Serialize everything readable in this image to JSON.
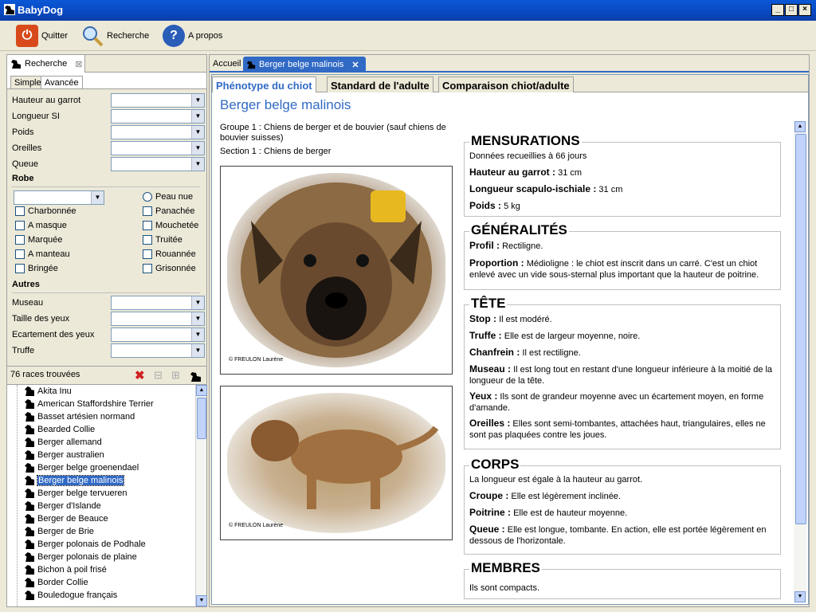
{
  "window": {
    "title": "BabyDog"
  },
  "toolbar": {
    "quit_label": "Quitter",
    "search_label": "Recherche",
    "about_label": "A propos"
  },
  "left": {
    "view_tab": "Recherche",
    "subtab_simple": "Simple",
    "subtab_advanced": "Avancée",
    "fields": [
      {
        "label": "Hauteur au garrot"
      },
      {
        "label": "Longueur SI"
      },
      {
        "label": "Poids"
      },
      {
        "label": "Oreilles"
      },
      {
        "label": "Queue"
      }
    ],
    "robe_heading": "Robe",
    "robe_radio": "Peau nue",
    "robe_checks_left": [
      "Charbonnée",
      "A masque",
      "Marquée",
      "A manteau",
      "Bringée"
    ],
    "robe_checks_right": [
      "Panachée",
      "Mouchetée",
      "Truitée",
      "Rouannée",
      "Grisonnée"
    ],
    "autres_heading": "Autres",
    "autres_fields": [
      {
        "label": "Museau"
      },
      {
        "label": "Taille des yeux"
      },
      {
        "label": "Ecartement des yeux"
      },
      {
        "label": "Truffe"
      }
    ],
    "results_count": "76 races trouvées",
    "breeds": [
      "Akita Inu",
      "American Staffordshire Terrier",
      "Basset artésien normand",
      "Bearded Collie",
      "Berger allemand",
      "Berger australien",
      "Berger belge groenendael",
      "Berger belge malinois",
      "Berger belge tervueren",
      "Berger d'Islande",
      "Berger de Beauce",
      "Berger de Brie",
      "Berger polonais de Podhale",
      "Berger polonais de plaine",
      "Bichon à poil frisé",
      "Border Collie",
      "Bouledogue français"
    ],
    "selected_index": 7
  },
  "right": {
    "tab_home": "Accueil",
    "tab_breed": "Berger belge malinois",
    "content_tabs": [
      "Phénotype du chiot",
      "Standard de l'adulte",
      "Comparaison chiot/adulte"
    ],
    "breed_title": "Berger belge malinois",
    "group_text": "Groupe 1 : Chiens de berger et de bouvier (sauf chiens de bouvier suisses)",
    "section_text": "Section 1 : Chiens de berger",
    "photo_credit_1": "© FREULON Laurène",
    "photo_credit_2": "© FREULON Laurène",
    "mensurations": {
      "title": "MENSURATIONS",
      "note": "Données recueillies à 66 jours",
      "rows": [
        {
          "k": "Hauteur au garrot :",
          "v": "31 cm"
        },
        {
          "k": "Longueur scapulo-ischiale :",
          "v": "31 cm"
        },
        {
          "k": "Poids :",
          "v": "5 kg"
        }
      ]
    },
    "generalites": {
      "title": "GÉNÉRALITÉS",
      "rows": [
        {
          "k": "Profil :",
          "v": "Rectiligne."
        },
        {
          "k": "Proportion :",
          "v": "Médioligne : le chiot est inscrit dans un carré. C'est un chiot enlevé avec un vide sous-sternal plus important que la hauteur de poitrine."
        }
      ]
    },
    "tete": {
      "title": "TÊTE",
      "rows": [
        {
          "k": "Stop :",
          "v": "Il est modéré."
        },
        {
          "k": "Truffe :",
          "v": "Elle est de largeur moyenne, noire."
        },
        {
          "k": "Chanfrein :",
          "v": "Il est rectiligne."
        },
        {
          "k": "Museau :",
          "v": "Il est long tout en restant d'une longueur inférieure à la moitié de la longueur de la tête."
        },
        {
          "k": "Yeux :",
          "v": "Ils sont de grandeur moyenne avec un écartement moyen, en forme d'amande."
        },
        {
          "k": "Oreilles :",
          "v": "Elles sont semi-tombantes, attachées haut, triangulaires, elles ne sont pas plaquées contre les joues."
        }
      ]
    },
    "corps": {
      "title": "CORPS",
      "note": "La longueur est égale à la hauteur au garrot.",
      "rows": [
        {
          "k": "Croupe :",
          "v": "Elle est légèrement inclinée."
        },
        {
          "k": "Poitrine :",
          "v": "Elle est de hauteur moyenne."
        },
        {
          "k": "Queue :",
          "v": "Elle est longue, tombante. En action, elle est portée légèrement en dessous de l'horizontale."
        }
      ]
    },
    "membres": {
      "title": "MEMBRES",
      "note": "Ils sont compacts."
    }
  },
  "colors": {
    "accent": "#316ac5",
    "titlebar": "#0a58d6"
  }
}
